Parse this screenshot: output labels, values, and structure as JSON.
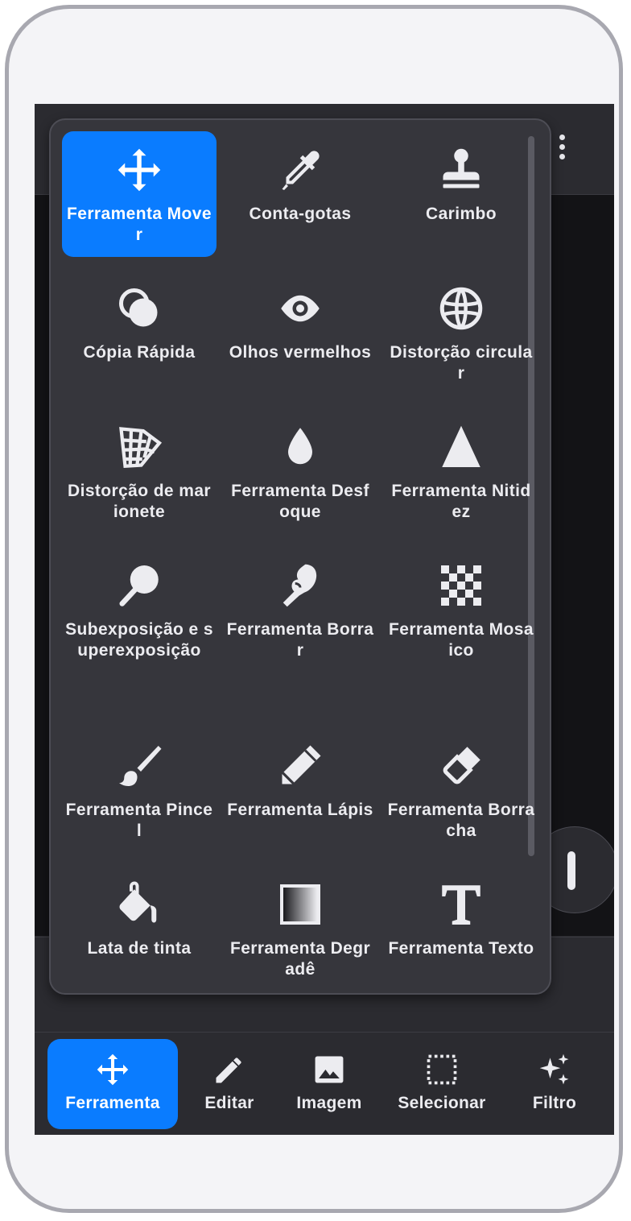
{
  "tools": [
    {
      "label": "Ferramenta Mover",
      "icon": "move-icon",
      "selected": true
    },
    {
      "label": "Conta-gotas",
      "icon": "eyedropper-icon"
    },
    {
      "label": "Carimbo",
      "icon": "stamp-icon"
    },
    {
      "label": "Cópia Rápida",
      "icon": "quick-copy-icon"
    },
    {
      "label": "Olhos vermelhos",
      "icon": "eye-icon"
    },
    {
      "label": "Distorção circular",
      "icon": "globe-icon"
    },
    {
      "label": "Distorção de marionete",
      "icon": "mesh-warp-icon"
    },
    {
      "label": "Ferramenta Desfoque",
      "icon": "drop-icon"
    },
    {
      "label": "Ferramenta Nitidez",
      "icon": "triangle-icon"
    },
    {
      "label": "Subexposição e superexposição",
      "icon": "dodge-burn-icon"
    },
    {
      "label": "Ferramenta Borrar",
      "icon": "smudge-finger-icon"
    },
    {
      "label": "Ferramenta Mosaico",
      "icon": "checkerboard-icon"
    },
    {
      "label": "Ferramenta Pincel",
      "icon": "brush-icon"
    },
    {
      "label": "Ferramenta Lápis",
      "icon": "pencil-icon"
    },
    {
      "label": "Ferramenta Borracha",
      "icon": "eraser-icon"
    },
    {
      "label": "Lata de tinta",
      "icon": "paint-bucket-icon"
    },
    {
      "label": "Ferramenta Degradê",
      "icon": "gradient-icon"
    },
    {
      "label": "Ferramenta Texto",
      "icon": "text-icon"
    }
  ],
  "nav": [
    {
      "label": "Ferramenta",
      "icon": "move-icon",
      "active": true
    },
    {
      "label": "Editar",
      "icon": "pencil-icon"
    },
    {
      "label": "Imagem",
      "icon": "image-icon"
    },
    {
      "label": "Selecionar",
      "icon": "selection-icon"
    },
    {
      "label": "Filtro",
      "icon": "sparkles-icon"
    }
  ],
  "colors": {
    "accent": "#0a7cff",
    "panel": "#36363c",
    "background": "#2b2b30"
  }
}
